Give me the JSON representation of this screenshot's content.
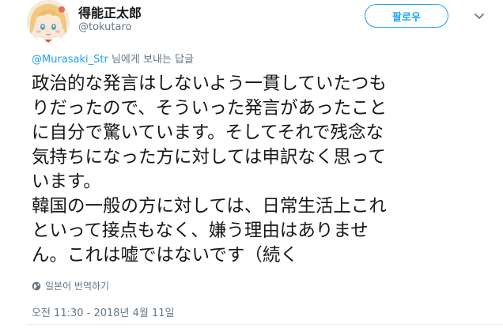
{
  "author": {
    "display_name": "得能正太郎",
    "handle": "@tokutaro"
  },
  "follow_button_label": "팔로우",
  "reply_context": {
    "username": "@Murasaki_Str",
    "suffix": " 님에게 보내는 답글"
  },
  "tweet_lines": [
    "政治的な発言はしないよう一貫していたつも",
    "りだったので、そういった発言があったこと",
    "に自分で驚いています。そしてそれで残念な",
    "気持ちになった方に対しては申訳なく思って",
    "います。",
    "韓国の一般の方に対しては、日常生活上これ",
    "といって接点もなく、嫌う理由はありませ",
    "ん。これは嘘ではないです（続く"
  ],
  "translate_label": "일본어 번역하기",
  "timestamp": "오전 11:30 - 2018년 4월 11일",
  "colors": {
    "accent": "#1da1f2",
    "muted": "#657786",
    "text": "#14171a"
  },
  "icons": {
    "translate": "globe-icon",
    "more": "chevron-down-icon"
  }
}
